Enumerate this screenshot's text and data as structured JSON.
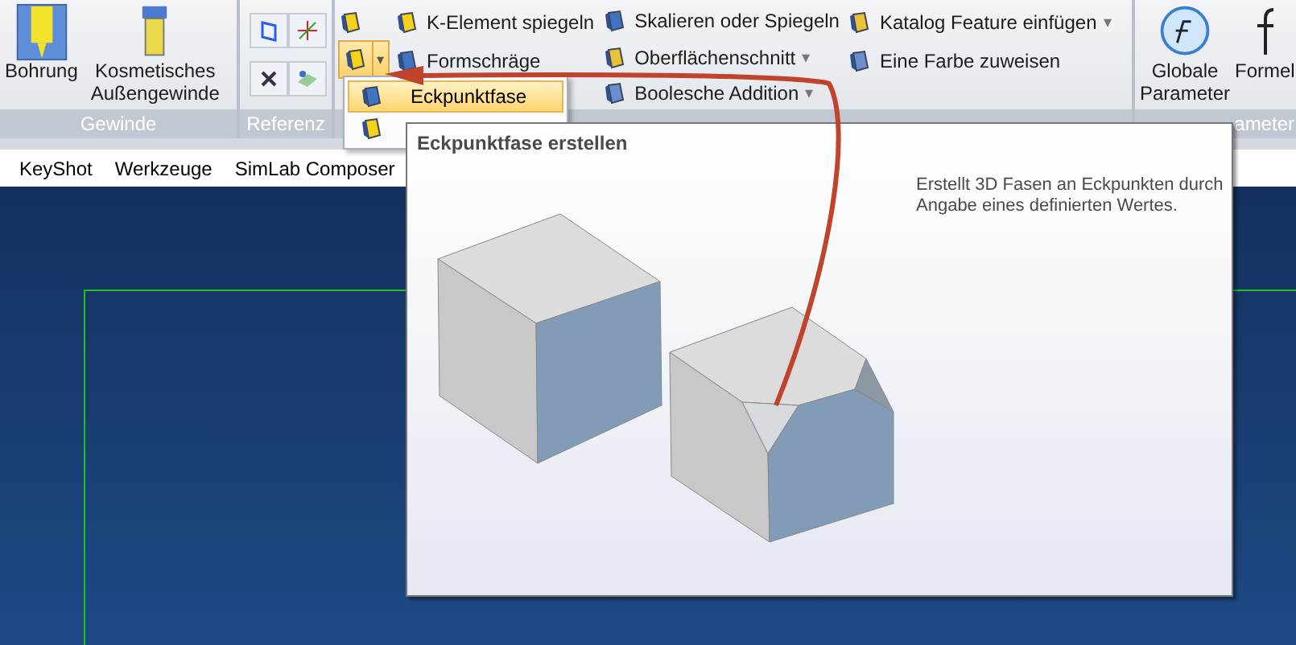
{
  "ribbon": {
    "groups": [
      {
        "kind": "large",
        "label": "Gewinde",
        "buttons": [
          {
            "label": "Bohrung"
          },
          {
            "label": "Kosmetisches Außengewinde"
          }
        ]
      },
      {
        "kind": "icons",
        "label": "Referenz"
      },
      {
        "kind": "list",
        "split_button": {
          "pressed": true,
          "arrow": "▾"
        },
        "columns": [
          [
            {
              "label": "K-Element spiegeln"
            },
            {
              "label": "Formschräge"
            }
          ],
          [
            {
              "label": "Skalieren oder Spiegeln"
            },
            {
              "label": "Oberflächenschnitt",
              "arrow": "▾"
            },
            {
              "label": "Boolesche Addition",
              "arrow": "▾"
            }
          ],
          [
            {
              "label": "Katalog Feature einfügen",
              "arrow": "▾"
            },
            {
              "label": "Eine Farbe zuweisen"
            }
          ]
        ]
      },
      {
        "kind": "large",
        "label": "ameter",
        "buttons": [
          {
            "label": "Globale Parameter"
          },
          {
            "label": "Formel"
          }
        ]
      }
    ]
  },
  "menu_bar": [
    "KeyShot",
    "Werkzeuge",
    "SimLab Composer"
  ],
  "dropdown": {
    "items": [
      {
        "label": "Eckpunktfase",
        "selected": true
      },
      {
        "selected": false
      }
    ]
  },
  "tooltip": {
    "title": "Eckpunktfase erstellen",
    "description": "Erstellt 3D Fasen an Eckpunkten durch Angabe eines definierten Wertes."
  }
}
